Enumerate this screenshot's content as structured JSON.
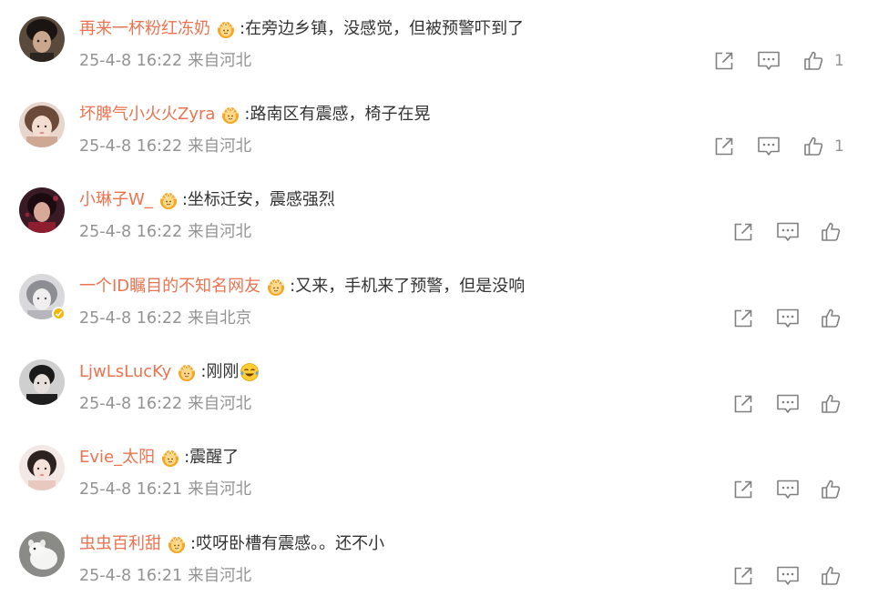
{
  "colors": {
    "username": "#eb7350",
    "text": "#333333",
    "meta": "#939393",
    "icon": "#808080",
    "vip_gold": "#f5a623",
    "verified": "#f7b500"
  },
  "icons": {
    "share": "share-icon",
    "comment": "comment-icon",
    "like": "like-icon",
    "vip": "vip-crown-icon",
    "emoji": "laughing-tears-emoji"
  },
  "comments": [
    {
      "username": "再来一杯粉红冻奶",
      "text": ":在旁边乡镇，没感觉，但被预警吓到了",
      "time": "25-4-8 16:22",
      "source": "来自河北",
      "likes": "1"
    },
    {
      "username": "坏脾气小火火Zyra",
      "text": ":路南区有震感，椅子在晃",
      "time": "25-4-8 16:22",
      "source": "来自河北",
      "likes": "1"
    },
    {
      "username": "小琳子W_",
      "text": ":坐标迁安，震感强烈",
      "time": "25-4-8 16:22",
      "source": "来自河北",
      "likes": ""
    },
    {
      "username": "一个ID瞩目的不知名网友",
      "text": ":又来，手机来了预警，但是没响",
      "time": "25-4-8 16:22",
      "source": "来自北京",
      "likes": ""
    },
    {
      "username": "LjwLsLucKy",
      "text": ":刚刚",
      "time": "25-4-8 16:22",
      "source": "来自河北",
      "likes": ""
    },
    {
      "username": "Evie_太阳",
      "text": ":震醒了",
      "time": "25-4-8 16:21",
      "source": "来自河北",
      "likes": ""
    },
    {
      "username": "虫虫百利甜",
      "text": ":哎呀卧槽有震感。。还不小",
      "time": "25-4-8 16:21",
      "source": "来自河北",
      "likes": ""
    }
  ]
}
